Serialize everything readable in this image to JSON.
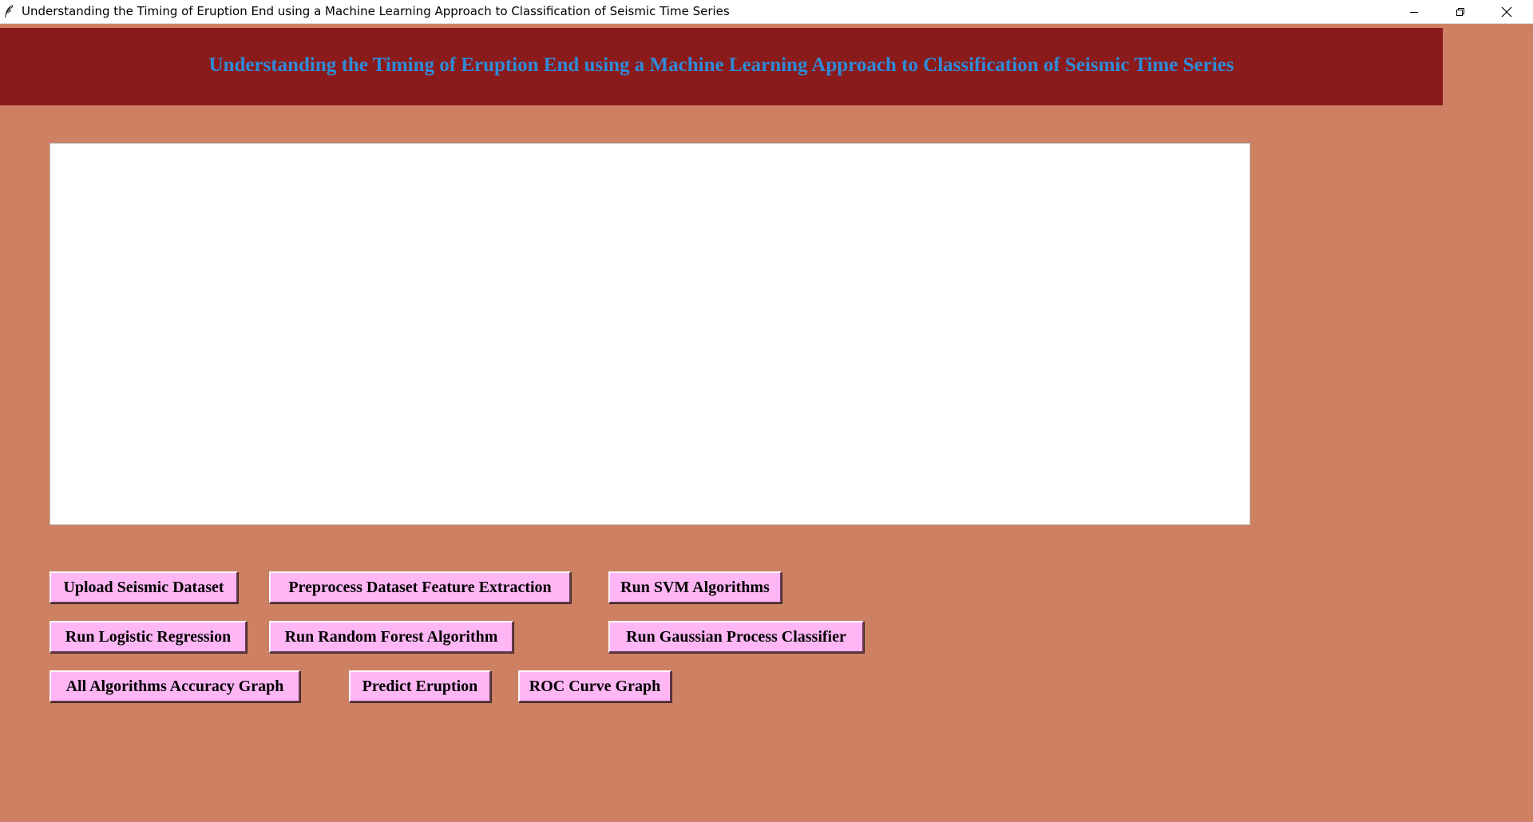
{
  "window": {
    "title": "Understanding the Timing of Eruption End using a Machine Learning Approach to Classification of Seismic Time Series",
    "icon": "feather-icon",
    "controls": [
      "minimize-icon",
      "restore-icon",
      "close-icon"
    ]
  },
  "header": {
    "title": "Understanding the Timing of Eruption End using a Machine Learning Approach to Classification of Seismic Time Series"
  },
  "output_area": {
    "text": ""
  },
  "buttons": {
    "upload": "Upload Seismic Dataset",
    "preprocess": "Preprocess Dataset Feature Extraction",
    "svm": "Run SVM Algorithms",
    "logistic": "Run Logistic Regression",
    "random_forest": "Run Random Forest Algorithm",
    "gaussian": "Run Gaussian Process Classifier",
    "accuracy_graph": "All Algorithms Accuracy Graph",
    "predict": "Predict Eruption",
    "roc": "ROC Curve Graph"
  },
  "colors": {
    "background": "#cd8162",
    "header_background": "#8b1a1a",
    "header_text": "#2e8bd8",
    "button_background": "#ffb6f4",
    "output_background": "#ffffff"
  }
}
